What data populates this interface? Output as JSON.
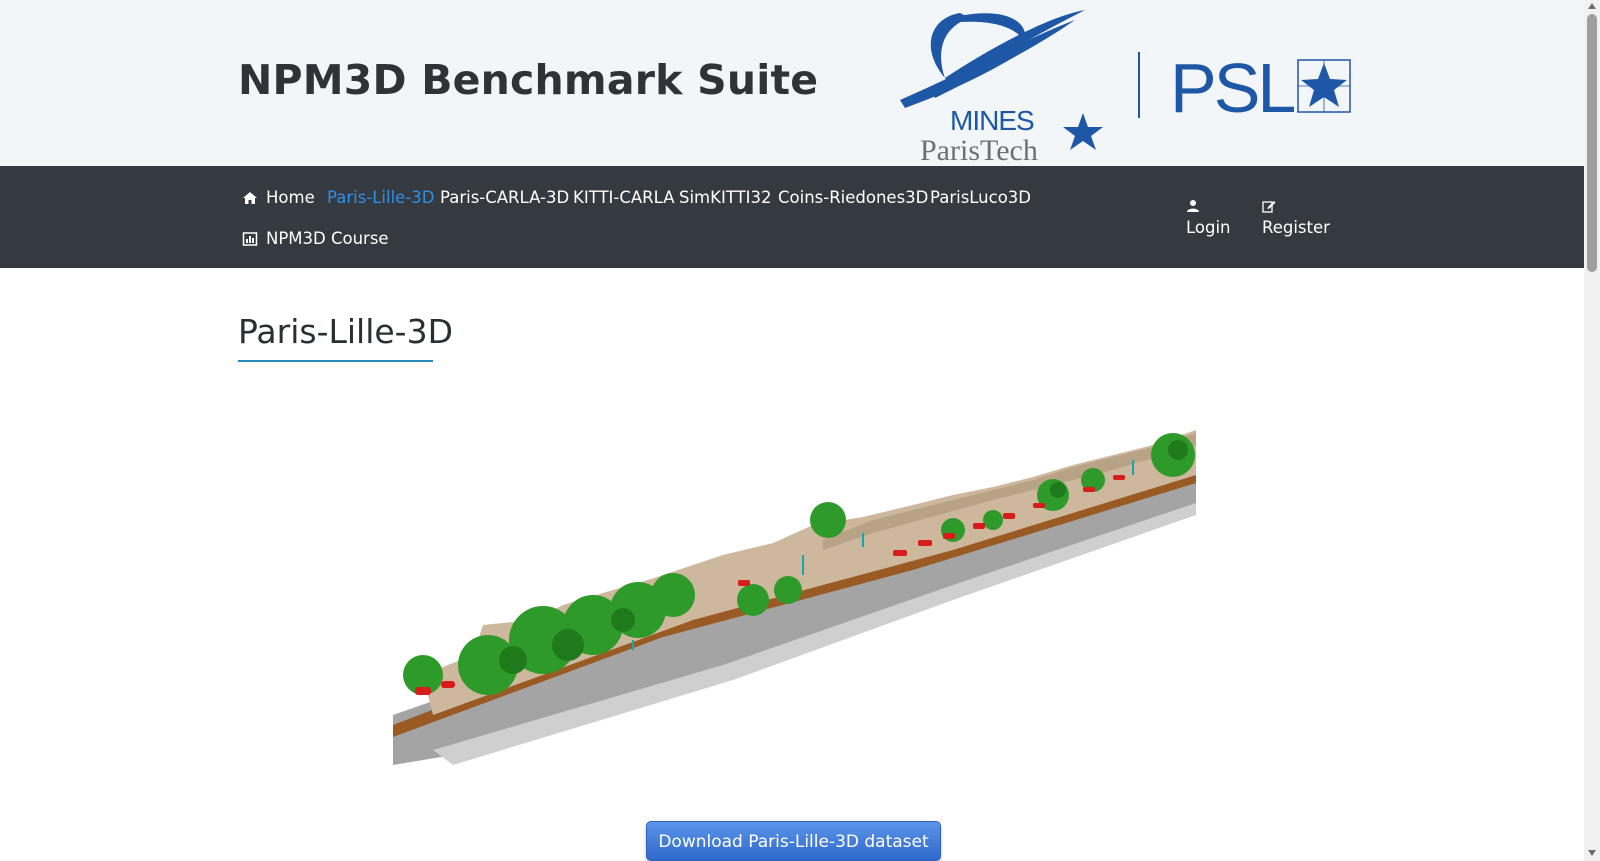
{
  "header": {
    "site_title": "NPM3D Benchmark Suite",
    "logo_mines_line1": "MINES",
    "logo_mines_line2": "ParisTech",
    "logo_psl": "PSL",
    "brand_color": "#1e57a6"
  },
  "nav": {
    "items": [
      {
        "label": "Home",
        "icon": "home-icon",
        "active": false
      },
      {
        "label": "Paris-Lille-3D",
        "active": true
      },
      {
        "label": "Paris-CARLA-3D",
        "active": false
      },
      {
        "label": "KITTI-CARLA",
        "active": false
      },
      {
        "label": "SimKITTI32",
        "active": false
      },
      {
        "label": "Coins-Riedones3D",
        "active": false
      },
      {
        "label": "ParisLuco3D",
        "active": false
      },
      {
        "label": "NPM3D Course",
        "icon": "bar-chart-icon",
        "active": false
      }
    ],
    "login": {
      "label": "Login",
      "icon": "user-icon"
    },
    "register": {
      "label": "Register",
      "icon": "edit-icon"
    },
    "background": "#353a40",
    "active_color": "#2e8fe6"
  },
  "main": {
    "title": "Paris-Lille-3D",
    "download_button": "Download Paris-Lille-3D dataset"
  }
}
